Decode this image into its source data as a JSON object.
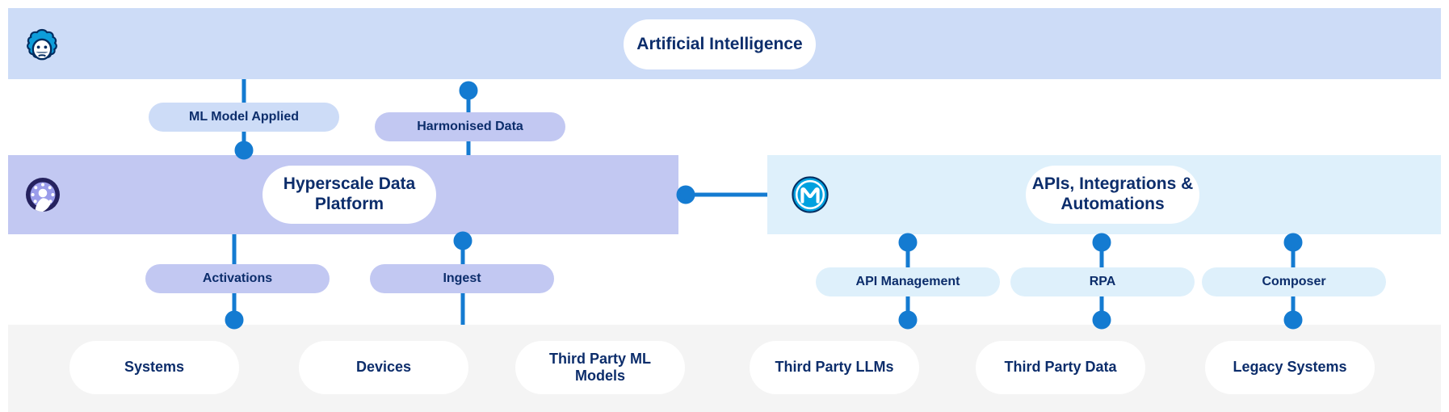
{
  "diagram": {
    "title": "Salesforce data and AI platform architecture",
    "colors": {
      "accent_line": "#147bd1",
      "ai_band": "#cddcf7",
      "data_band": "#c2c8f2",
      "mulesoft_band": "#def0fb",
      "systems_band": "#f4f4f4",
      "text": "#0c2d6b",
      "card": "#ffffff"
    }
  },
  "layers": {
    "ai": {
      "name": "artificial-intelligence-layer",
      "icon": "einstein-icon",
      "title": "Artificial Intelligence"
    },
    "data": {
      "name": "hyperscale-data-platform-layer",
      "icon": "data-cloud-icon",
      "title": "Hyperscale Data\nPlatform"
    },
    "integration": {
      "name": "mulesoft-layer",
      "icon": "mulesoft-icon",
      "title": "APIs, Integrations &\nAutomations"
    },
    "systems": {
      "name": "systems-layer"
    }
  },
  "connectors": {
    "ai_to_data": [
      {
        "label": "ML Model Applied",
        "style": "blue-lt"
      },
      {
        "label": "Harmonised Data",
        "style": "purple"
      }
    ],
    "data_to_systems": [
      {
        "label": "Activations",
        "style": "purple"
      },
      {
        "label": "Ingest",
        "style": "purple"
      }
    ],
    "integration_to_systems": [
      {
        "label": "API Management",
        "style": "cyan-lt"
      },
      {
        "label": "RPA",
        "style": "cyan-lt"
      },
      {
        "label": "Composer",
        "style": "cyan-lt"
      }
    ]
  },
  "systems": [
    {
      "label": "Systems"
    },
    {
      "label": "Devices"
    },
    {
      "label": "Third Party ML\nModels"
    },
    {
      "label": "Third Party LLMs"
    },
    {
      "label": "Third Party Data"
    },
    {
      "label": "Legacy Systems"
    }
  ]
}
